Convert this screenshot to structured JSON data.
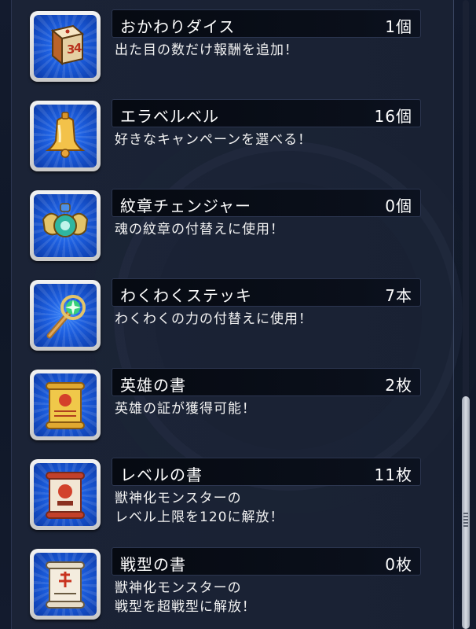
{
  "items": [
    {
      "name": "おかわりダイス",
      "count": "1個",
      "desc": [
        "出た目の数だけ報酬を追加！"
      ],
      "icon": "dice-icon"
    },
    {
      "name": "エラベルベル",
      "count": "16個",
      "desc": [
        "好きなキャンペーンを選べる！"
      ],
      "icon": "bell-icon"
    },
    {
      "name": "紋章チェンジャー",
      "count": "0個",
      "desc": [
        "魂の紋章の付替えに使用！"
      ],
      "icon": "emblem-changer-icon"
    },
    {
      "name": "わくわくステッキ",
      "count": "7本",
      "desc": [
        "わくわくの力の付替えに使用！"
      ],
      "icon": "stick-icon"
    },
    {
      "name": "英雄の書",
      "count": "2枚",
      "desc": [
        "英雄の証が獲得可能！"
      ],
      "icon": "hero-scroll-icon"
    },
    {
      "name": "レベルの書",
      "count": "11枚",
      "desc": [
        "獣神化モンスターの",
        "レベル上限を120に解放！"
      ],
      "icon": "level-scroll-icon"
    },
    {
      "name": "戦型の書",
      "count": "0枚",
      "desc": [
        "獣神化モンスターの",
        "戦型を超戦型に解放！"
      ],
      "icon": "battle-type-scroll-icon"
    }
  ],
  "colors": {
    "background": "#0c1424",
    "panel": "#1b2336",
    "name_bar": "#060a12",
    "icon_bg": "#1d5fe0",
    "text": "#ffffff"
  }
}
